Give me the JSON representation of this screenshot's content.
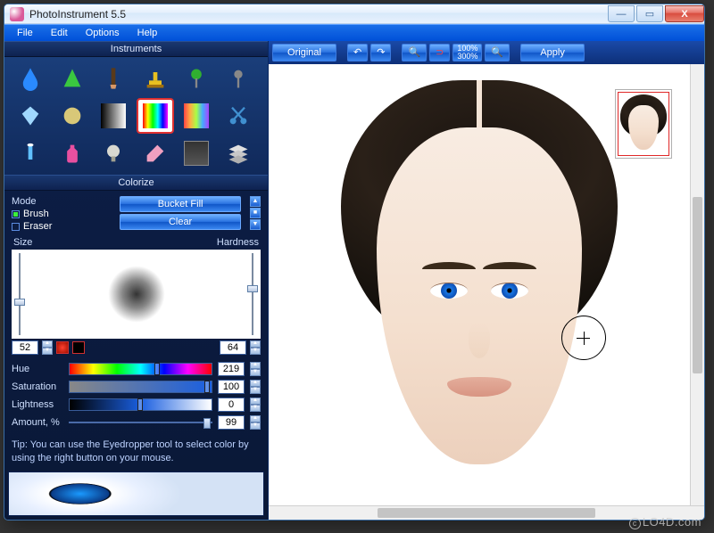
{
  "app": {
    "title": "PhotoInstrument 5.5"
  },
  "menu": {
    "file": "File",
    "edit": "Edit",
    "options": "Options",
    "help": "Help"
  },
  "panels": {
    "instruments_title": "Instruments",
    "colorize_title": "Colorize"
  },
  "tools": [
    "blur-drop",
    "sharpen-cone",
    "brush",
    "clone-stamp",
    "pin",
    "dodge",
    "diamond",
    "sphere",
    "gradient",
    "rainbow",
    "rainbow-soft",
    "scissors",
    "tube",
    "bottle",
    "bulb",
    "eraser",
    "photo-frame",
    "layers-stack"
  ],
  "selected_tool": "rainbow",
  "mode": {
    "label": "Mode",
    "brush": "Brush",
    "eraser": "Eraser",
    "bucket_fill": "Bucket Fill",
    "clear": "Clear"
  },
  "brush": {
    "size_label": "Size",
    "hardness_label": "Hardness",
    "size": "52",
    "hardness": "64"
  },
  "sliders": {
    "hue": {
      "label": "Hue",
      "value": "219"
    },
    "saturation": {
      "label": "Saturation",
      "value": "100"
    },
    "lightness": {
      "label": "Lightness",
      "value": "0"
    },
    "amount": {
      "label": "Amount, %",
      "value": "99"
    }
  },
  "tip": "Tip: You can use the Eyedropper tool to select color by using the right button on your mouse.",
  "toolbar": {
    "original": "Original",
    "apply": "Apply",
    "zoom1": "100%",
    "zoom2": "300%"
  },
  "watermark": "LO4D.com"
}
